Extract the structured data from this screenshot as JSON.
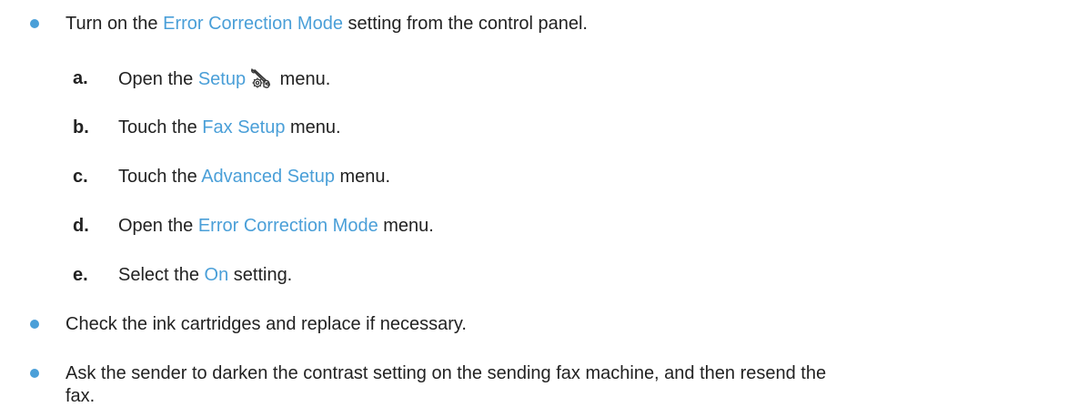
{
  "bullets": [
    {
      "pre": "Turn on the ",
      "link": "Error Correction Mode",
      "post": " setting from the control panel.",
      "steps": [
        {
          "letter": "a.",
          "pre": "Open the ",
          "link": "Setup",
          "post": " menu.",
          "icon": "setup-wrench-gear-icon"
        },
        {
          "letter": "b.",
          "pre": "Touch the ",
          "link": "Fax Setup",
          "post": " menu."
        },
        {
          "letter": "c.",
          "pre": "Touch the ",
          "link": "Advanced Setup",
          "post": " menu."
        },
        {
          "letter": "d.",
          "pre": "Open the ",
          "link": "Error Correction Mode",
          "post": " menu."
        },
        {
          "letter": "e.",
          "pre": "Select the ",
          "link": "On",
          "post": " setting."
        }
      ]
    },
    {
      "text": "Check the ink cartridges and replace if necessary."
    },
    {
      "text_line1": "Ask the sender to darken the contrast setting on the sending fax machine, and then resend the",
      "text_line2": "fax."
    }
  ],
  "colors": {
    "accent": "#4a9fd8",
    "text": "#222222"
  }
}
